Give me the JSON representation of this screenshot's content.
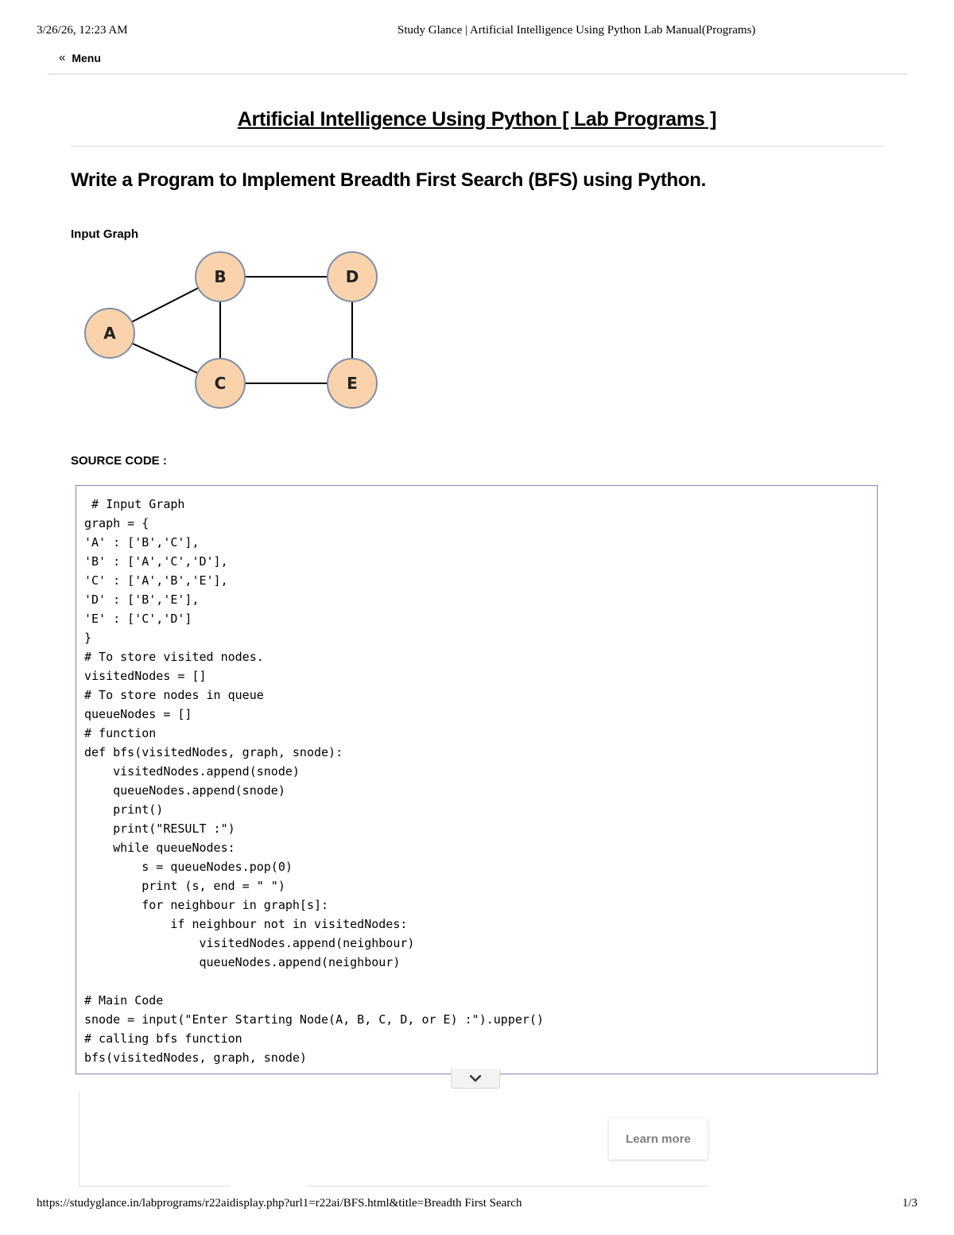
{
  "print_header": {
    "datetime": "3/26/26, 12:23 AM",
    "doc_title": "Study Glance | Artificial Intelligence Using Python Lab Manual(Programs)"
  },
  "nav": {
    "menu_label": "Menu",
    "menu_icon": "«"
  },
  "page_title": "Artificial Intelligence Using Python [ Lab Programs ]",
  "program_heading": "Write a Program to Implement Breadth First Search (BFS) using Python.",
  "input_graph": {
    "label": "Input Graph",
    "node_fill": "#fad3ac",
    "node_stroke": "#7f8fa6",
    "nodes": [
      "A",
      "B",
      "C",
      "D",
      "E"
    ],
    "edges": [
      [
        "A",
        "B"
      ],
      [
        "A",
        "C"
      ],
      [
        "B",
        "C"
      ],
      [
        "B",
        "D"
      ],
      [
        "C",
        "E"
      ],
      [
        "D",
        "E"
      ]
    ]
  },
  "source_label": "SOURCE CODE :",
  "source_code": " # Input Graph\ngraph = {\n'A' : ['B','C'],\n'B' : ['A','C','D'],\n'C' : ['A','B','E'],\n'D' : ['B','E'],\n'E' : ['C','D']\n}\n# To store visited nodes.\nvisitedNodes = []\n# To store nodes in queue\nqueueNodes = []\n# function\ndef bfs(visitedNodes, graph, snode):\n    visitedNodes.append(snode)\n    queueNodes.append(snode)\n    print()\n    print(\"RESULT :\")\n    while queueNodes:\n        s = queueNodes.pop(0)\n        print (s, end = \" \")\n        for neighbour in graph[s]:\n            if neighbour not in visitedNodes:\n                visitedNodes.append(neighbour)\n                queueNodes.append(neighbour)\n\n# Main Code\nsnode = input(\"Enter Starting Node(A, B, C, D, or E) :\").upper()\n# calling bfs function\nbfs(visitedNodes, graph, snode)",
  "ad": {
    "learn_more_label": "Learn more"
  },
  "print_footer": {
    "url": "https://studyglance.in/labprograms/r22aidisplay.php?url1=r22ai/BFS.html&title=Breadth First Search",
    "page": "1/3"
  },
  "colors": {
    "code_border": "#8f7fb8",
    "node_fill": "#fad3ac"
  }
}
